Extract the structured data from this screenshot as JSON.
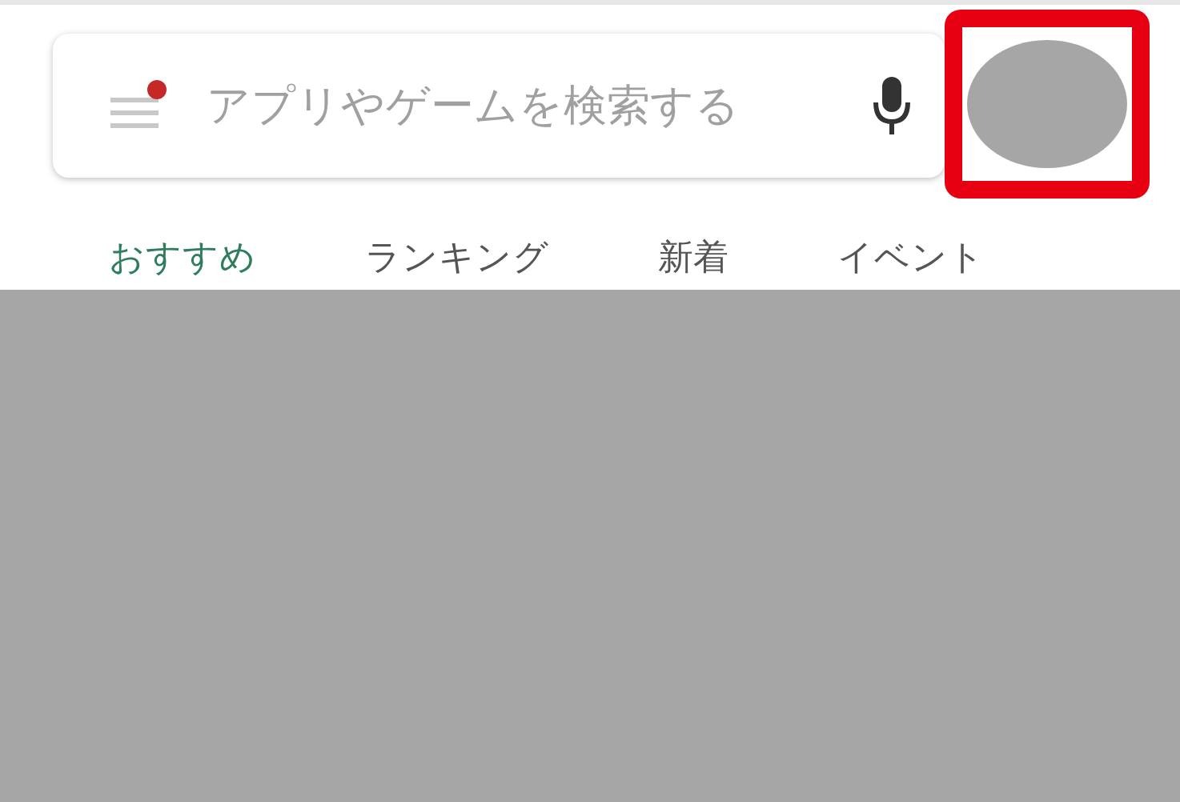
{
  "search": {
    "placeholder": "アプリやゲームを検索する",
    "menu_badge": true
  },
  "account": {
    "highlighted": true
  },
  "tabs": [
    {
      "label": "おすすめ",
      "selected": true
    },
    {
      "label": "ランキング",
      "selected": false
    },
    {
      "label": "新着",
      "selected": false
    },
    {
      "label": "イベント",
      "selected": false
    }
  ]
}
